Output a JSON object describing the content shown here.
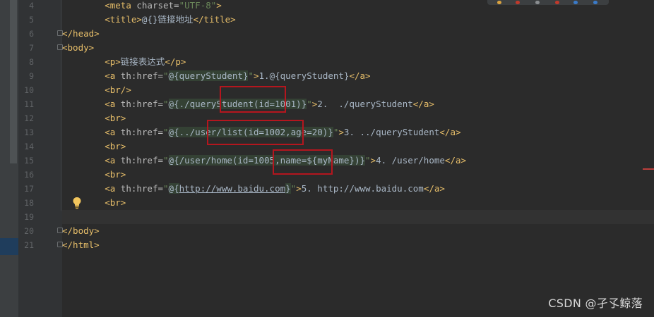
{
  "editor": {
    "lines": [
      {
        "num": "4",
        "segments": [
          {
            "t": "        "
          },
          {
            "t": "<meta ",
            "c": "tag"
          },
          {
            "t": "charset=",
            "c": "attr"
          },
          {
            "t": "\"UTF-8\"",
            "c": "str"
          },
          {
            "t": ">",
            "c": "tag"
          }
        ]
      },
      {
        "num": "5",
        "segments": [
          {
            "t": "        "
          },
          {
            "t": "<title>",
            "c": "tag"
          },
          {
            "t": "@{}链接地址"
          },
          {
            "t": "</title>",
            "c": "tag"
          }
        ]
      },
      {
        "num": "6",
        "segments": [
          {
            "t": "</head>",
            "c": "tag"
          }
        ]
      },
      {
        "num": "7",
        "segments": [
          {
            "t": "<body>",
            "c": "tag"
          }
        ]
      },
      {
        "num": "8",
        "segments": [
          {
            "t": "        "
          },
          {
            "t": "<p>",
            "c": "tag"
          },
          {
            "t": "链接表达式"
          },
          {
            "t": "</p>",
            "c": "tag"
          }
        ]
      },
      {
        "num": "9",
        "segments": [
          {
            "t": "        "
          },
          {
            "t": "<a ",
            "c": "tag"
          },
          {
            "t": "th:href=",
            "c": "attr"
          },
          {
            "t": "\"",
            "c": "str"
          },
          {
            "t": "@{",
            "c": "ex"
          },
          {
            "t": "queryStudent",
            "c": "ex"
          },
          {
            "t": "}",
            "c": "ex"
          },
          {
            "t": "\"",
            "c": "str"
          },
          {
            "t": ">",
            "c": "tag"
          },
          {
            "t": "1.@{queryStudent}"
          },
          {
            "t": "</a>",
            "c": "tag"
          }
        ]
      },
      {
        "num": "10",
        "segments": [
          {
            "t": "        "
          },
          {
            "t": "<br/>",
            "c": "tag"
          }
        ]
      },
      {
        "num": "11",
        "segments": [
          {
            "t": "        "
          },
          {
            "t": "<a ",
            "c": "tag"
          },
          {
            "t": "th:href=",
            "c": "attr"
          },
          {
            "t": "\"",
            "c": "str"
          },
          {
            "t": "@{",
            "c": "ex"
          },
          {
            "t": "./queryStudent(id=1001)",
            "c": "ex"
          },
          {
            "t": "}",
            "c": "ex"
          },
          {
            "t": "\"",
            "c": "str"
          },
          {
            "t": ">",
            "c": "tag"
          },
          {
            "t": "2.  ./queryStudent"
          },
          {
            "t": "</a>",
            "c": "tag"
          }
        ]
      },
      {
        "num": "12",
        "segments": [
          {
            "t": "        "
          },
          {
            "t": "<br>",
            "c": "tag"
          }
        ]
      },
      {
        "num": "13",
        "segments": [
          {
            "t": "        "
          },
          {
            "t": "<a ",
            "c": "tag"
          },
          {
            "t": "th:href=",
            "c": "attr"
          },
          {
            "t": "\"",
            "c": "str"
          },
          {
            "t": "@{",
            "c": "ex"
          },
          {
            "t": "../user/list(id=1002,age=20)",
            "c": "ex"
          },
          {
            "t": "}",
            "c": "ex"
          },
          {
            "t": "\"",
            "c": "str"
          },
          {
            "t": ">",
            "c": "tag"
          },
          {
            "t": "3. ../queryStudent"
          },
          {
            "t": "</a>",
            "c": "tag"
          }
        ]
      },
      {
        "num": "14",
        "segments": [
          {
            "t": "        "
          },
          {
            "t": "<br>",
            "c": "tag"
          }
        ]
      },
      {
        "num": "15",
        "segments": [
          {
            "t": "        "
          },
          {
            "t": "<a ",
            "c": "tag"
          },
          {
            "t": "th:href=",
            "c": "attr"
          },
          {
            "t": "\"",
            "c": "str"
          },
          {
            "t": "@{",
            "c": "ex"
          },
          {
            "t": "/user/home(id=1005,name=${myName})",
            "c": "ex"
          },
          {
            "t": "}",
            "c": "ex"
          },
          {
            "t": "\"",
            "c": "str"
          },
          {
            "t": ">",
            "c": "tag"
          },
          {
            "t": "4. /user/home"
          },
          {
            "t": "</a>",
            "c": "tag"
          }
        ]
      },
      {
        "num": "16",
        "segments": [
          {
            "t": "        "
          },
          {
            "t": "<br>",
            "c": "tag"
          }
        ]
      },
      {
        "num": "17",
        "segments": [
          {
            "t": "        "
          },
          {
            "t": "<a ",
            "c": "tag"
          },
          {
            "t": "th:href=",
            "c": "attr"
          },
          {
            "t": "\"",
            "c": "str"
          },
          {
            "t": "@{",
            "c": "ex"
          },
          {
            "t": "http://www.baidu.com",
            "c": "link"
          },
          {
            "t": "}",
            "c": "ex"
          },
          {
            "t": "\"",
            "c": "str"
          },
          {
            "t": ">",
            "c": "tag"
          },
          {
            "t": "5. http://www.baidu.com"
          },
          {
            "t": "</a>",
            "c": "tag"
          }
        ]
      },
      {
        "num": "18",
        "segments": [
          {
            "t": "        "
          },
          {
            "t": "<br>",
            "c": "tag"
          }
        ]
      },
      {
        "num": "19",
        "segments": []
      },
      {
        "num": "20",
        "segments": [
          {
            "t": "</body>",
            "c": "tag"
          }
        ]
      },
      {
        "num": "21",
        "segments": [
          {
            "t": "</html>",
            "c": "tag"
          }
        ]
      }
    ],
    "current_line": "19",
    "intention_icon": "lightbulb-icon"
  },
  "watermark": {
    "text": "CSDN @孑孓鲸落"
  },
  "colors": {
    "background": "#2b2b2b",
    "gutter": "#313335",
    "tag": "#e8bf6a",
    "attribute": "#bababa",
    "string": "#6a8759",
    "text": "#a9b7c6",
    "annotation_box": "#b4161e"
  }
}
